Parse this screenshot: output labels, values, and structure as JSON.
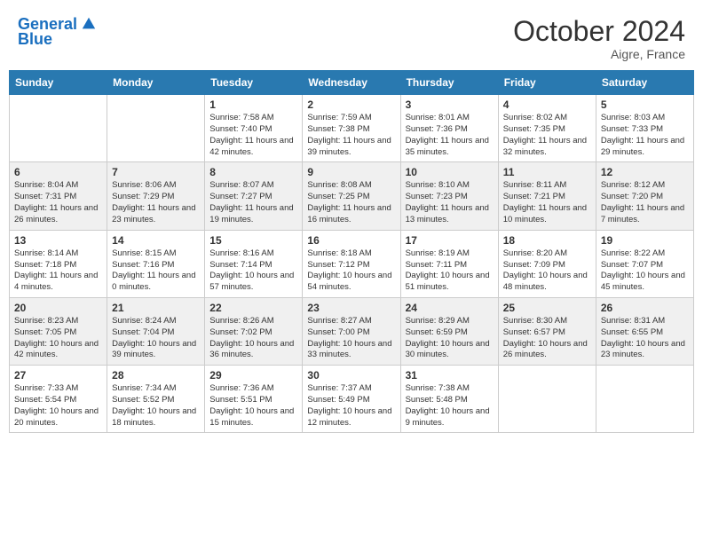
{
  "header": {
    "logo_line1": "General",
    "logo_line2": "Blue",
    "month": "October 2024",
    "location": "Aigre, France"
  },
  "weekdays": [
    "Sunday",
    "Monday",
    "Tuesday",
    "Wednesday",
    "Thursday",
    "Friday",
    "Saturday"
  ],
  "weeks": [
    [
      {
        "day": "",
        "sunrise": "",
        "sunset": "",
        "daylight": ""
      },
      {
        "day": "",
        "sunrise": "",
        "sunset": "",
        "daylight": ""
      },
      {
        "day": "1",
        "sunrise": "Sunrise: 7:58 AM",
        "sunset": "Sunset: 7:40 PM",
        "daylight": "Daylight: 11 hours and 42 minutes."
      },
      {
        "day": "2",
        "sunrise": "Sunrise: 7:59 AM",
        "sunset": "Sunset: 7:38 PM",
        "daylight": "Daylight: 11 hours and 39 minutes."
      },
      {
        "day": "3",
        "sunrise": "Sunrise: 8:01 AM",
        "sunset": "Sunset: 7:36 PM",
        "daylight": "Daylight: 11 hours and 35 minutes."
      },
      {
        "day": "4",
        "sunrise": "Sunrise: 8:02 AM",
        "sunset": "Sunset: 7:35 PM",
        "daylight": "Daylight: 11 hours and 32 minutes."
      },
      {
        "day": "5",
        "sunrise": "Sunrise: 8:03 AM",
        "sunset": "Sunset: 7:33 PM",
        "daylight": "Daylight: 11 hours and 29 minutes."
      }
    ],
    [
      {
        "day": "6",
        "sunrise": "Sunrise: 8:04 AM",
        "sunset": "Sunset: 7:31 PM",
        "daylight": "Daylight: 11 hours and 26 minutes."
      },
      {
        "day": "7",
        "sunrise": "Sunrise: 8:06 AM",
        "sunset": "Sunset: 7:29 PM",
        "daylight": "Daylight: 11 hours and 23 minutes."
      },
      {
        "day": "8",
        "sunrise": "Sunrise: 8:07 AM",
        "sunset": "Sunset: 7:27 PM",
        "daylight": "Daylight: 11 hours and 19 minutes."
      },
      {
        "day": "9",
        "sunrise": "Sunrise: 8:08 AM",
        "sunset": "Sunset: 7:25 PM",
        "daylight": "Daylight: 11 hours and 16 minutes."
      },
      {
        "day": "10",
        "sunrise": "Sunrise: 8:10 AM",
        "sunset": "Sunset: 7:23 PM",
        "daylight": "Daylight: 11 hours and 13 minutes."
      },
      {
        "day": "11",
        "sunrise": "Sunrise: 8:11 AM",
        "sunset": "Sunset: 7:21 PM",
        "daylight": "Daylight: 11 hours and 10 minutes."
      },
      {
        "day": "12",
        "sunrise": "Sunrise: 8:12 AM",
        "sunset": "Sunset: 7:20 PM",
        "daylight": "Daylight: 11 hours and 7 minutes."
      }
    ],
    [
      {
        "day": "13",
        "sunrise": "Sunrise: 8:14 AM",
        "sunset": "Sunset: 7:18 PM",
        "daylight": "Daylight: 11 hours and 4 minutes."
      },
      {
        "day": "14",
        "sunrise": "Sunrise: 8:15 AM",
        "sunset": "Sunset: 7:16 PM",
        "daylight": "Daylight: 11 hours and 0 minutes."
      },
      {
        "day": "15",
        "sunrise": "Sunrise: 8:16 AM",
        "sunset": "Sunset: 7:14 PM",
        "daylight": "Daylight: 10 hours and 57 minutes."
      },
      {
        "day": "16",
        "sunrise": "Sunrise: 8:18 AM",
        "sunset": "Sunset: 7:12 PM",
        "daylight": "Daylight: 10 hours and 54 minutes."
      },
      {
        "day": "17",
        "sunrise": "Sunrise: 8:19 AM",
        "sunset": "Sunset: 7:11 PM",
        "daylight": "Daylight: 10 hours and 51 minutes."
      },
      {
        "day": "18",
        "sunrise": "Sunrise: 8:20 AM",
        "sunset": "Sunset: 7:09 PM",
        "daylight": "Daylight: 10 hours and 48 minutes."
      },
      {
        "day": "19",
        "sunrise": "Sunrise: 8:22 AM",
        "sunset": "Sunset: 7:07 PM",
        "daylight": "Daylight: 10 hours and 45 minutes."
      }
    ],
    [
      {
        "day": "20",
        "sunrise": "Sunrise: 8:23 AM",
        "sunset": "Sunset: 7:05 PM",
        "daylight": "Daylight: 10 hours and 42 minutes."
      },
      {
        "day": "21",
        "sunrise": "Sunrise: 8:24 AM",
        "sunset": "Sunset: 7:04 PM",
        "daylight": "Daylight: 10 hours and 39 minutes."
      },
      {
        "day": "22",
        "sunrise": "Sunrise: 8:26 AM",
        "sunset": "Sunset: 7:02 PM",
        "daylight": "Daylight: 10 hours and 36 minutes."
      },
      {
        "day": "23",
        "sunrise": "Sunrise: 8:27 AM",
        "sunset": "Sunset: 7:00 PM",
        "daylight": "Daylight: 10 hours and 33 minutes."
      },
      {
        "day": "24",
        "sunrise": "Sunrise: 8:29 AM",
        "sunset": "Sunset: 6:59 PM",
        "daylight": "Daylight: 10 hours and 30 minutes."
      },
      {
        "day": "25",
        "sunrise": "Sunrise: 8:30 AM",
        "sunset": "Sunset: 6:57 PM",
        "daylight": "Daylight: 10 hours and 26 minutes."
      },
      {
        "day": "26",
        "sunrise": "Sunrise: 8:31 AM",
        "sunset": "Sunset: 6:55 PM",
        "daylight": "Daylight: 10 hours and 23 minutes."
      }
    ],
    [
      {
        "day": "27",
        "sunrise": "Sunrise: 7:33 AM",
        "sunset": "Sunset: 5:54 PM",
        "daylight": "Daylight: 10 hours and 20 minutes."
      },
      {
        "day": "28",
        "sunrise": "Sunrise: 7:34 AM",
        "sunset": "Sunset: 5:52 PM",
        "daylight": "Daylight: 10 hours and 18 minutes."
      },
      {
        "day": "29",
        "sunrise": "Sunrise: 7:36 AM",
        "sunset": "Sunset: 5:51 PM",
        "daylight": "Daylight: 10 hours and 15 minutes."
      },
      {
        "day": "30",
        "sunrise": "Sunrise: 7:37 AM",
        "sunset": "Sunset: 5:49 PM",
        "daylight": "Daylight: 10 hours and 12 minutes."
      },
      {
        "day": "31",
        "sunrise": "Sunrise: 7:38 AM",
        "sunset": "Sunset: 5:48 PM",
        "daylight": "Daylight: 10 hours and 9 minutes."
      },
      {
        "day": "",
        "sunrise": "",
        "sunset": "",
        "daylight": ""
      },
      {
        "day": "",
        "sunrise": "",
        "sunset": "",
        "daylight": ""
      }
    ]
  ]
}
